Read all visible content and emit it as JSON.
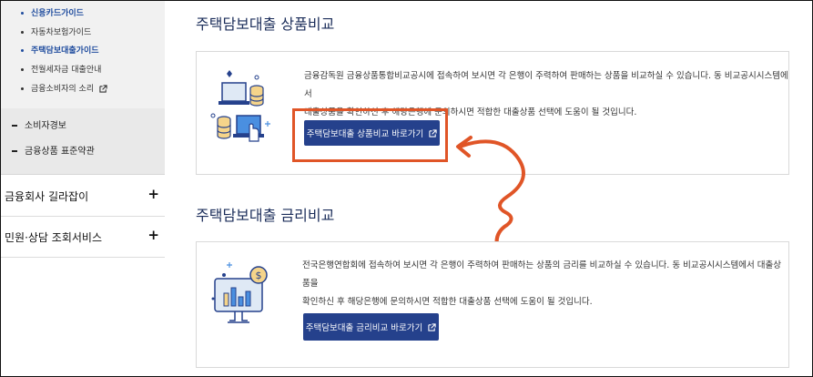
{
  "sidebar": {
    "sub_items": [
      {
        "label": "신용카드가이드",
        "active": true
      },
      {
        "label": "자동차보험가이드",
        "active": false
      },
      {
        "label": "주택담보대출가이드",
        "active": true
      },
      {
        "label": "전월세자금 대출안내",
        "active": false
      },
      {
        "label": "금융소비자의 소리",
        "active": false,
        "external": true
      }
    ],
    "dash_items": [
      "소비자경보",
      "금융상품 표준약관"
    ],
    "menu_items": [
      {
        "label": "금융회사 길라잡이",
        "toggle": "+"
      },
      {
        "label": "민원·상담 조회서비스",
        "toggle": "+"
      }
    ]
  },
  "sections": [
    {
      "title": "주택담보대출 상품비교",
      "description_lines": [
        "금융감독원 금융상품통합비교공시에 접속하여 보시면 각 은행이 주력하여 판매하는 상품을 비교하실 수 있습니다. 동 비교공시시스템에서",
        "대출상품을 확인하신 후 해당은행에 문의하시면 적합한 대출상품 선택에 도움이 될 것입니다."
      ],
      "button_label": "주택담보대출 상품비교 바로가기",
      "icon": "laptop-coins-hand-icon"
    },
    {
      "title": "주택담보대출 금리비교",
      "description_lines": [
        "전국은행연합회에 접속하여 보시면 각 은행이 주력하여 판매하는 상품의 금리를 비교하실 수 있습니다. 동 비교공시시스템에서 대출상품을",
        "확인하신 후 해당은행에 문의하시면 적합한 대출상품 선택에 도움이 될 것입니다."
      ],
      "button_label": "주택담보대출 금리비교 바로가기",
      "icon": "monitor-chart-dollar-icon"
    }
  ],
  "colors": {
    "button": "#25418c",
    "highlight": "#e05527",
    "title": "#1b2d5a",
    "active_link": "#1f4c9e"
  }
}
